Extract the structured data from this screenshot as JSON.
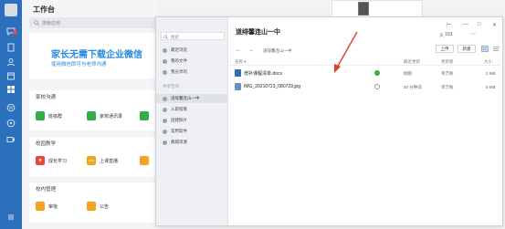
{
  "workbench": {
    "title": "工作台",
    "search_placeholder": "搜索应用",
    "banner_line1": "家长无需下载企业微信",
    "banner_line2": "使用微信即可与老师沟通",
    "sections": [
      {
        "title": "家校沟通",
        "apps": [
          {
            "label": "班级群",
            "color": "#2fae4a",
            "glyph": "群"
          },
          {
            "label": "家校通讯录",
            "color": "#2fae4a",
            "glyph": "通"
          },
          {
            "label": "",
            "color": "#2fae4a",
            "glyph": "…"
          }
        ]
      },
      {
        "title": "校园教学",
        "apps": [
          {
            "label": "成长学习",
            "color": "#e8473a",
            "glyph": "★"
          },
          {
            "label": "上课直播",
            "color": "#f3a41f",
            "glyph": "LIVE"
          },
          {
            "label": "",
            "color": "#f3a41f",
            "glyph": "…"
          }
        ]
      },
      {
        "title": "校内管理",
        "apps": [
          {
            "label": "审批",
            "color": "#f3a41f",
            "glyph": "审"
          },
          {
            "label": "公告",
            "color": "#f3a41f",
            "glyph": "告"
          }
        ]
      }
    ]
  },
  "dialog": {
    "search_placeholder": "搜索",
    "nav_items": [
      {
        "label": "最近浏览",
        "active": false
      },
      {
        "label": "我的文件",
        "active": false
      },
      {
        "label": "我分享的",
        "active": false
      }
    ],
    "shared_section_label": "共享空间",
    "space_items": [
      {
        "label": "道绯馨连山一中",
        "active": true
      },
      {
        "label": "入职指南",
        "active": false
      },
      {
        "label": "团建照片",
        "active": false
      },
      {
        "label": "常用软件",
        "active": false
      },
      {
        "label": "教辅资源",
        "active": false
      }
    ],
    "title": "道绯馨连山一中",
    "member_count": "103",
    "breadcrumb": "道绯馨连山一中",
    "upload_label": "上传",
    "new_label": "新建",
    "columns": {
      "name": "名称 ▾",
      "updated": "最近更新",
      "updater": "更新者",
      "size": "大小"
    },
    "files": [
      {
        "name": "增补课程清单.docx",
        "type": "docx",
        "icon_color": "#2b6fbd",
        "synced": true,
        "updated": "刚刚",
        "updater": "单万秋",
        "size": "2 MB"
      },
      {
        "name": "IMG_20210723_080729.jpg",
        "type": "jpg",
        "icon_color": "#6a8fc4",
        "synced": false,
        "updated": "20 分钟前",
        "updater": "单万秋",
        "size": "8 MB"
      }
    ],
    "accent_color": "#e23b2e"
  }
}
